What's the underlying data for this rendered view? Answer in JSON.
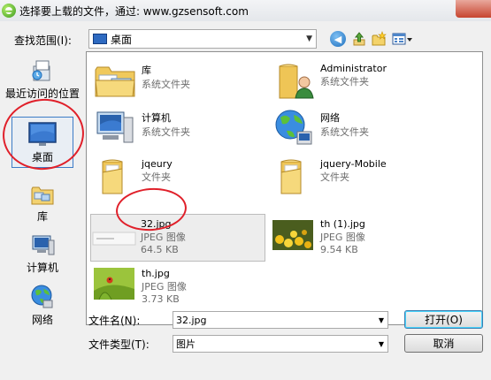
{
  "title": "选择要上载的文件，通过: www.gzsensoft.com",
  "look_in": {
    "label": "查找范围(I):",
    "value": "桌面"
  },
  "toolbar": {
    "back_icon": "back-arrow-icon",
    "up_icon": "up-folder-icon",
    "new_folder_icon": "new-folder-icon",
    "view_menu_icon": "view-menu-icon"
  },
  "places": [
    {
      "label": "最近访问的位置",
      "icon": "recent-places-icon"
    },
    {
      "label": "桌面",
      "icon": "desktop-icon"
    },
    {
      "label": "库",
      "icon": "library-icon"
    },
    {
      "label": "计算机",
      "icon": "computer-icon"
    },
    {
      "label": "网络",
      "icon": "network-icon"
    }
  ],
  "files": [
    {
      "name": "库",
      "sub1": "系统文件夹",
      "sub2": ""
    },
    {
      "name": "Administrator",
      "sub1": "系统文件夹",
      "sub2": ""
    },
    {
      "name": "计算机",
      "sub1": "系统文件夹",
      "sub2": ""
    },
    {
      "name": "网络",
      "sub1": "系统文件夹",
      "sub2": ""
    },
    {
      "name": "jqeury",
      "sub1": "文件夹",
      "sub2": ""
    },
    {
      "name": "jquery-Mobile",
      "sub1": "文件夹",
      "sub2": ""
    },
    {
      "name": "32.jpg",
      "sub1": "JPEG 图像",
      "sub2": "64.5 KB"
    },
    {
      "name": "th (1).jpg",
      "sub1": "JPEG 图像",
      "sub2": "9.54 KB"
    },
    {
      "name": "th.jpg",
      "sub1": "JPEG 图像",
      "sub2": "3.73 KB"
    }
  ],
  "filename": {
    "label": "文件名(N):",
    "value": "32.jpg"
  },
  "filetype": {
    "label": "文件类型(T):",
    "value": "图片"
  },
  "buttons": {
    "open": "打开(O)",
    "cancel": "取消"
  },
  "colors": {
    "annotation": "#e0202a",
    "selection_border": "#3d7cc6"
  }
}
